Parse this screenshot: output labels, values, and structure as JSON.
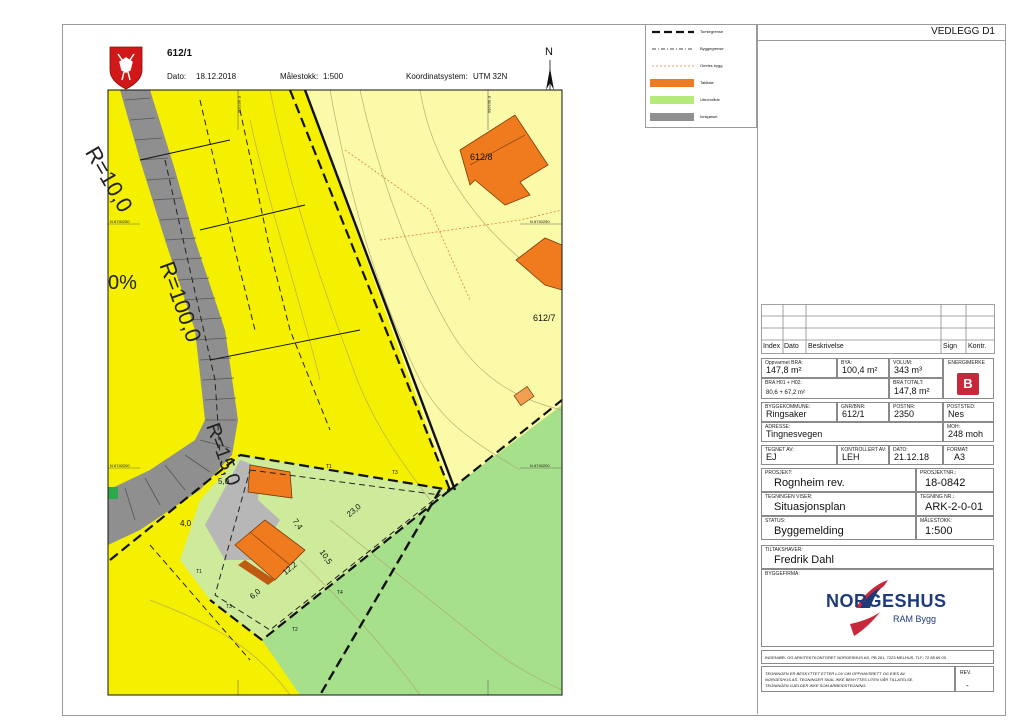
{
  "map": {
    "property_id": "612/1",
    "date_label": "Dato:",
    "date_value": "18.12.2018",
    "scale_label": "Målestokk:",
    "scale_value": "1:500",
    "coord_label": "Koordinatsystem:",
    "coord_value": "UTM 32N",
    "north_label": "N",
    "plots": [
      "612/8",
      "612/7"
    ],
    "grid_labels": [
      "E 603200",
      "E 603250",
      "N 6740250",
      "N 6740200",
      "N 6740250",
      "N 6740200"
    ],
    "curve_labels": [
      "R=10,0",
      "R=100,0",
      "R=15,0"
    ],
    "slope_label": "0%",
    "tree_marks": [
      "T1",
      "T1",
      "T2",
      "T3",
      "T3",
      "T4"
    ],
    "dimensions": [
      "5,0",
      "4,0",
      "7,4",
      "23,0",
      "10,5",
      "12,2",
      "6,0"
    ],
    "colors": {
      "yellow": "#f5f000",
      "light_yellow": "#fafaa8",
      "green": "#a6e08a",
      "light_green": "#cdeb9a",
      "orange": "#f07a1e",
      "grey": "#8f8f8f"
    }
  },
  "legend": {
    "items": [
      {
        "label": "Tomtegrense",
        "swatch": "thick-dash"
      },
      {
        "label": "Byggegrense",
        "swatch": "thin-dash"
      },
      {
        "label": "Omriss bygg",
        "swatch": "dotted-line"
      },
      {
        "label": "Takflate",
        "swatch": "#f07a1e"
      },
      {
        "label": "Uteområde",
        "swatch": "#b5e97a"
      },
      {
        "label": "Innkjørsel",
        "swatch": "#8f8f8f"
      }
    ]
  },
  "titleblock": {
    "attachment": "VEDLEGG D1",
    "revision_headers": [
      "Index",
      "Dato",
      "Beskrivelse",
      "Sign",
      "Kontr."
    ],
    "oppvarmet_bra_label": "Oppvarmet BRA:",
    "oppvarmet_bra_value": "147,8 m²",
    "bya_label": "BYA:",
    "bya_value": "100,4 m²",
    "volum_label": "VOLUM:",
    "volum_value": "343 m³",
    "energimerke_label": "ENERGIMERKE",
    "energimerke_value": "B",
    "bra_h_label": "BRA H01 + H02:",
    "bra_h_value": "80,6 + 67,2 m²",
    "bra_total_label": "BRA TOTALT:",
    "bra_total_value": "147,8 m²",
    "kommune_label": "BYGGEKOMMUNE:",
    "kommune_value": "Ringsaker",
    "gnr_label": "GNR/BNR:",
    "gnr_value": "612/1",
    "postnr_label": "POSTNR:",
    "postnr_value": "2350",
    "poststed_label": "POSTSTED:",
    "poststed_value": "Nes",
    "adresse_label": "ADRESSE:",
    "adresse_value": "Tingnesvegen",
    "moh_label": "MOH:",
    "moh_value": "248 moh",
    "tegnet_label": "TEGNET AV:",
    "tegnet_value": "EJ",
    "kontrollert_label": "KONTROLLERT AV:",
    "kontrollert_value": "LEH",
    "dato_label": "DATO:",
    "dato_value": "21.12.18",
    "format_label": "FORMAT:",
    "format_value": "A3",
    "prosjekt_label": "PROSJEKT:",
    "prosjekt_value": "Rognheim rev.",
    "prosjektnr_label": "PROSJEKTNR.:",
    "prosjektnr_value": "18-0842",
    "viser_label": "TEGNINGEN VISER:",
    "viser_value": "Situasjonsplan",
    "tegningnr_label": "TEGNING NR.:",
    "tegningnr_value": "ARK-2-0-01",
    "status_label": "STATUS:",
    "status_value": "Byggemelding",
    "malestokk_label": "MÅLESTOKK:",
    "malestokk_value": "1:500",
    "tiltakshaver_label": "TILTAKSHAVER:",
    "tiltakshaver_value": "Fredrik Dahl",
    "byggefirma_label": "BYGGEFIRMA:",
    "logo_text": "NORGESHUS",
    "logo_sub": "RAM Bygg",
    "office_line": "INGENIØR- OG ARKITEKTKONTORET NORGESHUS AS,  PB 261, 7223 MELHUS,  TLF: 72 85 69 00",
    "copyright_lines": [
      "TEGNINGEN ER BESKYTTET ETTER LOV OM OPPHAVSRETT OG EIES AV",
      "NORGESHUS AS. TEGNINGER SKAL IKKE BENYTTES UTEN VÅR TILLATELSE.",
      "TEGNINGEN GJELDER IKKE SOM ARBEIDSTEGNING."
    ],
    "rev_label": "REV.",
    "rev_value": "-"
  }
}
